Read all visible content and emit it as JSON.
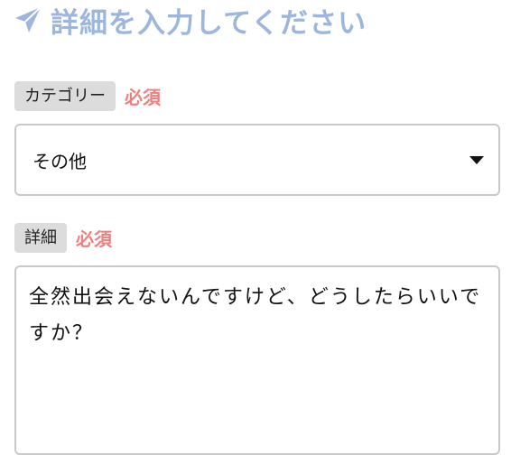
{
  "header": {
    "icon": "paper-plane-icon",
    "title": "詳細を入力してください",
    "accent_color": "#9db6de"
  },
  "category": {
    "label": "カテゴリー",
    "required_label": "必須",
    "selected_value": "その他"
  },
  "details": {
    "label": "詳細",
    "required_label": "必須",
    "value": "全然出会えないんですけど、どうしたらいいですか？"
  },
  "colors": {
    "required": "#ef7f7f",
    "tag_background": "#dcdcdc",
    "border": "#c9c9c9"
  }
}
